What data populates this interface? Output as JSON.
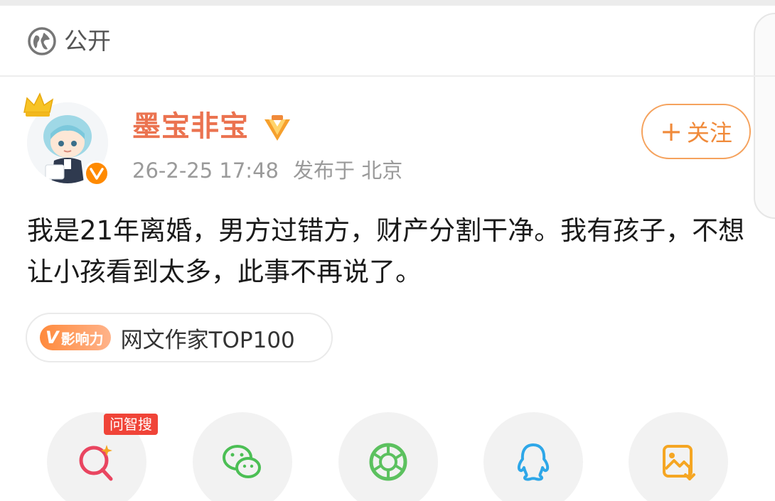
{
  "visibility": {
    "label": "公开",
    "icon": "globe-icon"
  },
  "author": {
    "name": "墨宝非宝",
    "verified": true,
    "name_color": "#eb7350",
    "timestamp": "26-2-25 17:48",
    "location": "发布于 北京"
  },
  "follow_button": {
    "label": "关注",
    "icon": "plus-icon",
    "accent": "#f08a3a"
  },
  "post": {
    "text": "我是21年离婚，男方过错方，财产分割干净。我有孩子，不想让小孩看到太多，此事不再说了。"
  },
  "influence_tag": {
    "badge": "影响力",
    "text": "网文作家TOP100"
  },
  "share_bar": {
    "ai_search_label": "问智搜",
    "buttons": [
      "ai-search-icon",
      "wechat-icon",
      "moments-icon",
      "qq-icon",
      "save-image-icon"
    ]
  }
}
